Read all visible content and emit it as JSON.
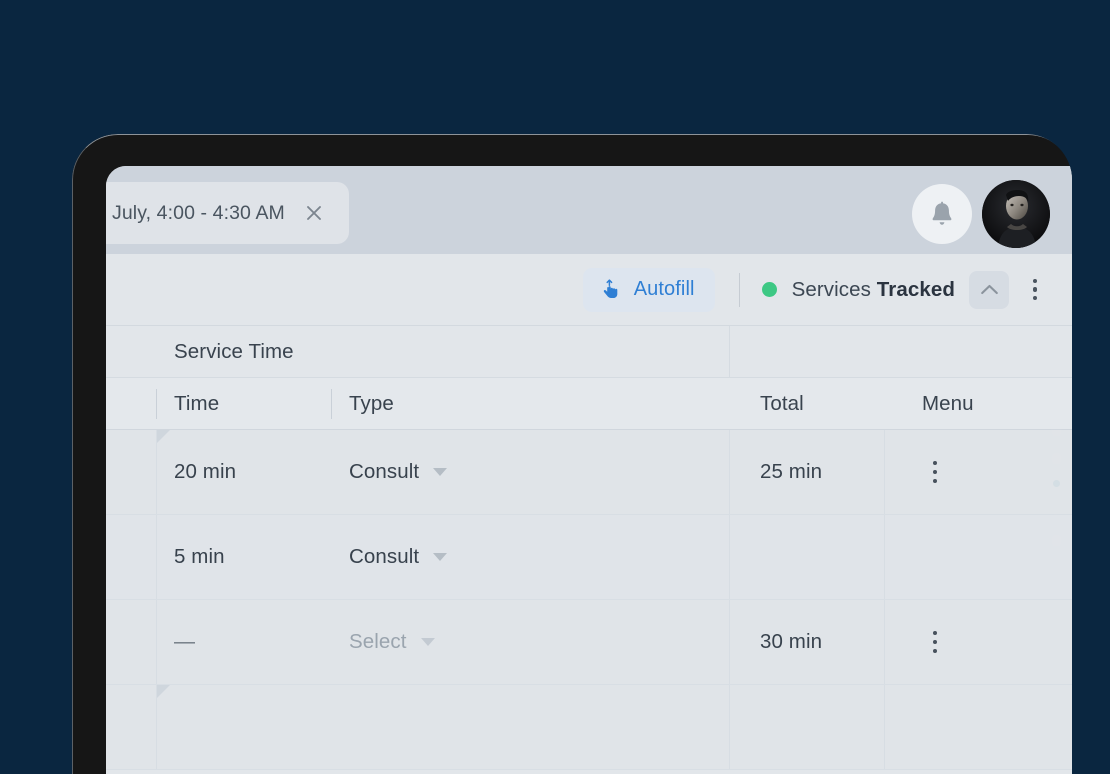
{
  "background_color": "#0a2640",
  "header": {
    "tab": {
      "label": "July, 4:00 - 4:30 AM",
      "close_icon": "close-icon"
    },
    "notifications_icon": "bell-icon",
    "avatar_alt": "user-avatar"
  },
  "toolbar": {
    "autofill_label": "Autofill",
    "autofill_icon": "tap-hand-icon",
    "status_dot_color": "#3dc884",
    "status_prefix": "Services",
    "status_value": "Tracked",
    "collapse_icon": "chevron-up-icon",
    "menu_icon": "kebab-menu-icon"
  },
  "table": {
    "group_header": "Service Time",
    "columns": [
      "Time",
      "Type",
      "Total",
      "Menu"
    ],
    "rows": [
      {
        "time": "20 min",
        "type": "Consult",
        "type_placeholder": false,
        "total": "25 min",
        "has_menu": true
      },
      {
        "time": "5 min",
        "type": "Consult",
        "type_placeholder": false,
        "total": "",
        "has_menu": false
      },
      {
        "time": "—",
        "type": "Select",
        "type_placeholder": true,
        "total": "30 min",
        "has_menu": true
      }
    ]
  }
}
